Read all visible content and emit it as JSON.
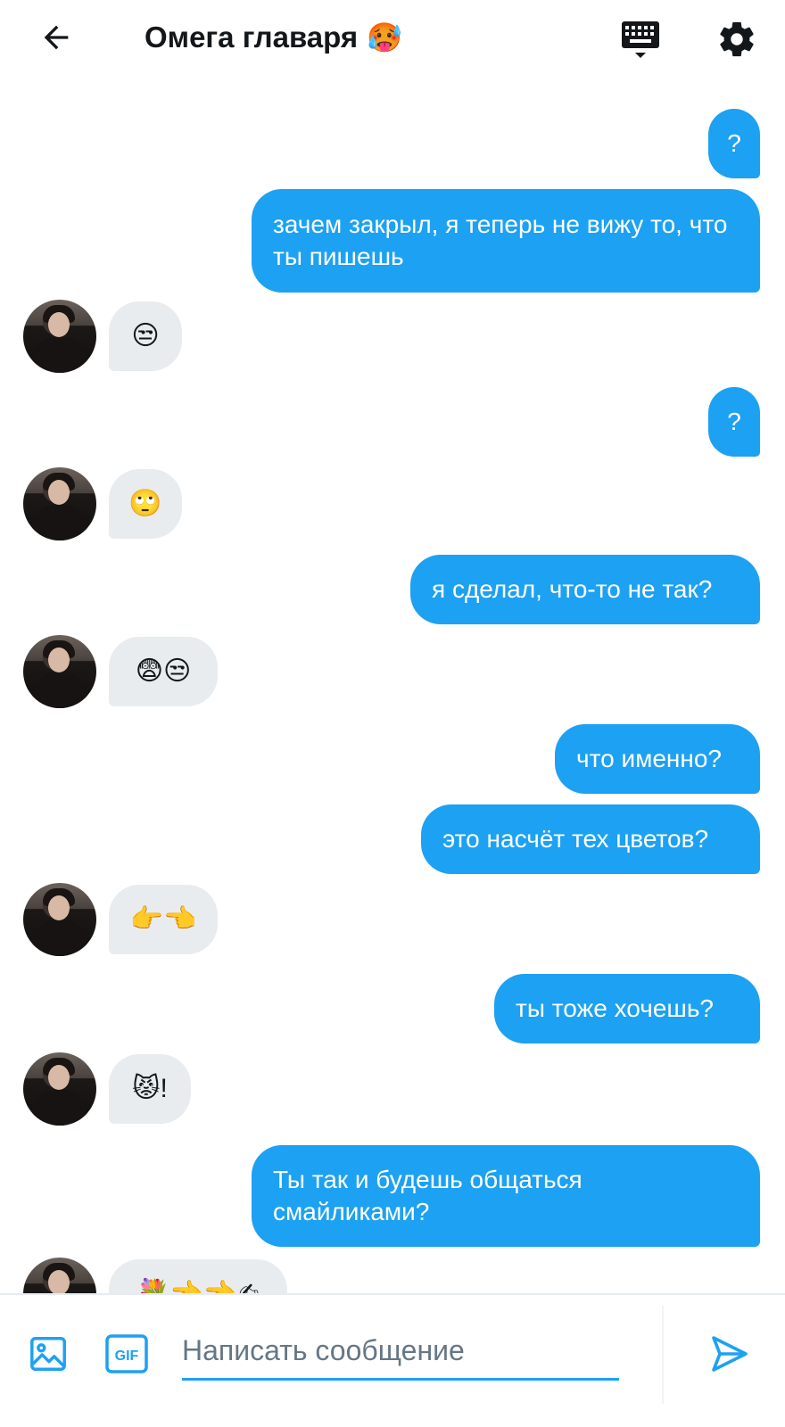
{
  "header": {
    "title": "Омега главаря",
    "title_emoji": "🥵",
    "back_icon": "arrow-left-icon",
    "keyboard_icon": "keyboard-icon",
    "settings_icon": "gear-icon"
  },
  "messages": [
    {
      "from": "me",
      "text": "?"
    },
    {
      "from": "me",
      "text": "зачем закрыл, я теперь не вижу то, что ты пишешь"
    },
    {
      "from": "them",
      "text": "😒"
    },
    {
      "from": "me",
      "text": "?"
    },
    {
      "from": "them",
      "text": "🙄"
    },
    {
      "from": "me",
      "text": "я сделал, что-то не так?"
    },
    {
      "from": "them",
      "text": "😨😒"
    },
    {
      "from": "me",
      "text": "что именно?"
    },
    {
      "from": "me",
      "text": "это насчёт тех цветов?"
    },
    {
      "from": "them",
      "text": "👉👈"
    },
    {
      "from": "me",
      "text": "ты тоже хочешь?"
    },
    {
      "from": "them",
      "text": "😾!"
    },
    {
      "from": "me",
      "text": "Ты так и будешь общаться смайликами?"
    },
    {
      "from": "them",
      "text": "💐👈👈✍"
    }
  ],
  "composer": {
    "placeholder": "Написать сообщение",
    "gif_label": "GIF",
    "image_icon": "image-icon",
    "send_icon": "send-icon"
  },
  "colors": {
    "accent": "#1da1f2",
    "incoming_bubble": "#e9ecef",
    "text": "#14171a",
    "placeholder": "#657786"
  }
}
